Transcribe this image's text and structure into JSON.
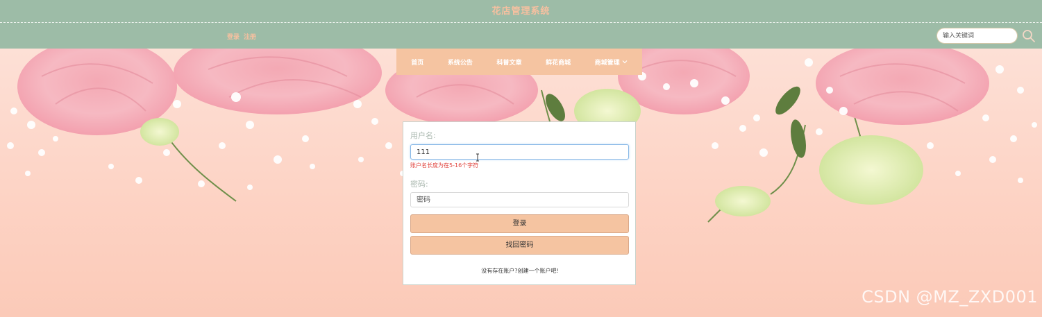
{
  "header": {
    "site_title": "花店管理系统",
    "login_link": "登录",
    "register_link": "注册",
    "search_placeholder": "输入关键词"
  },
  "nav": {
    "items": [
      "首页",
      "系统公告",
      "科普文章",
      "鲜花商城",
      "商城管理"
    ]
  },
  "login_form": {
    "username_label": "用户名:",
    "username_value": "111",
    "username_error": "账户名长度为在5-16个字符",
    "password_label": "密码:",
    "password_placeholder": "密码",
    "login_button": "登录",
    "forgot_button": "找回密码",
    "register_prompt": "没有存在账户?创建一个账户吧!"
  },
  "watermark": "CSDN @MZ_ZXD001",
  "colors": {
    "header_bg": "#9dbca7",
    "accent_peach": "#f5c4a1",
    "error_red": "#e0403a",
    "background_pink": "#fcd3c3"
  }
}
